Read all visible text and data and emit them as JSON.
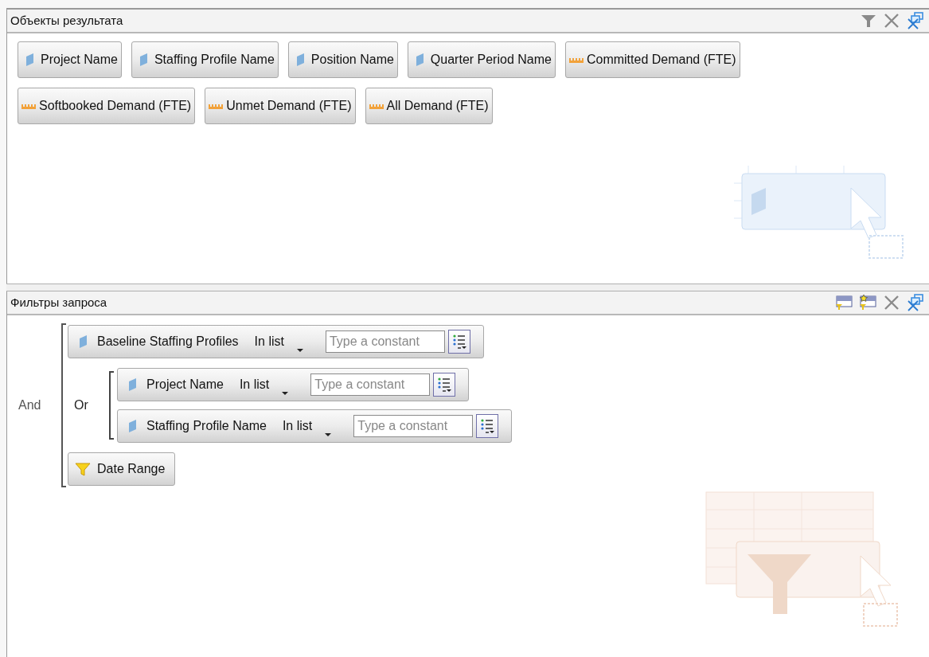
{
  "result_objects": {
    "title": "Объекты результата",
    "objects": [
      {
        "label": "Project Name",
        "kind": "dimension"
      },
      {
        "label": "Staffing Profile Name",
        "kind": "dimension"
      },
      {
        "label": "Position Name",
        "kind": "dimension"
      },
      {
        "label": "Quarter Period Name",
        "kind": "dimension"
      },
      {
        "label": "Committed Demand (FTE)",
        "kind": "measure"
      },
      {
        "label": "Softbooked Demand (FTE)",
        "kind": "measure"
      },
      {
        "label": "Unmet Demand (FTE)",
        "kind": "measure"
      },
      {
        "label": "All Demand (FTE)",
        "kind": "measure"
      }
    ]
  },
  "query_filters": {
    "title": "Фильтры запроса",
    "operator": "And",
    "items": [
      {
        "kind": "condition",
        "label": "Baseline Staffing Profiles",
        "operator": "In list",
        "placeholder": "Type a constant"
      },
      {
        "kind": "group",
        "operator": "Or",
        "children": [
          {
            "kind": "condition",
            "label": "Project Name",
            "operator": "In list",
            "placeholder": "Type a constant"
          },
          {
            "kind": "condition",
            "label": "Staffing Profile Name",
            "operator": "In list",
            "placeholder": "Type a constant"
          }
        ]
      },
      {
        "kind": "predefined",
        "label": "Date Range"
      }
    ]
  }
}
